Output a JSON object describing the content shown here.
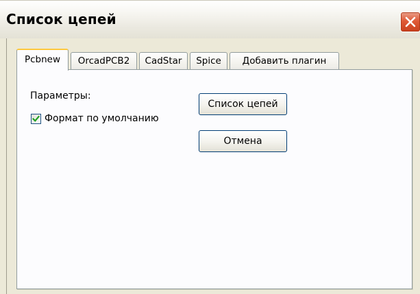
{
  "window": {
    "title": "Список цепей"
  },
  "tabs": [
    {
      "label": "Pcbnew",
      "active": true
    },
    {
      "label": "OrcadPCB2",
      "active": false
    },
    {
      "label": "CadStar",
      "active": false
    },
    {
      "label": "Spice",
      "active": false
    },
    {
      "label": "Добавить плагин",
      "active": false
    }
  ],
  "panel": {
    "params_label": "Параметры:",
    "default_format": {
      "label": "Формат по умолчанию",
      "checked": true
    },
    "netlist_button": "Список цепей",
    "cancel_button": "Отмена"
  },
  "colors": {
    "active_tab_accent": "#ffc83c",
    "close_button": "#e05a37",
    "check_mark": "#21a121"
  },
  "icons": {
    "close": "close-icon",
    "check": "check-icon"
  }
}
